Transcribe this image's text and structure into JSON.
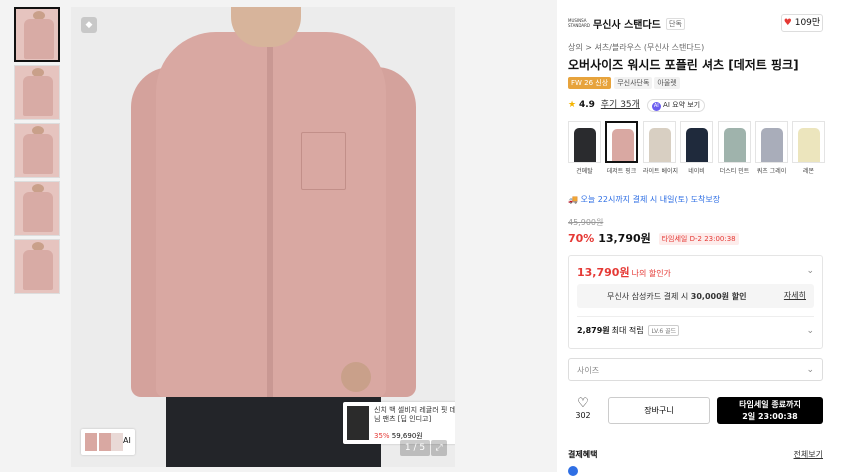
{
  "gallery": {
    "thumbnails": [
      "thumb-1",
      "thumb-2",
      "thumb-3",
      "thumb-4",
      "thumb-5"
    ],
    "pager": "1 / 5",
    "ai_label": "AI",
    "tagged_product": {
      "name": "신치 백 셀비지 레귤러 핏 데님 팬츠 [딥 인디고]",
      "discount": "35%",
      "price": "59,690원"
    }
  },
  "brand": {
    "logo": "MUSINSA STANDARD",
    "name": "무신사 스탠다드",
    "chip": "단독",
    "likes": "109만"
  },
  "breadcrumb": "상의 > 셔츠/블라우스 (무신사 스탠다드)",
  "title": "오버사이즈 워시드 포플린 셔츠 [데저트 핑크]",
  "tags": [
    "FW 26 신상",
    "무신사단독",
    "아울렛"
  ],
  "rating": {
    "score": "4.9",
    "reviews": "후기 35개",
    "ai_summary": "AI 요약 보기"
  },
  "colors": [
    {
      "label": "건메탈",
      "color": "#2a2b2e"
    },
    {
      "label": "데저트 핑크",
      "color": "#d9a8a2",
      "selected": true
    },
    {
      "label": "라이트 베이지",
      "color": "#d8cfc2"
    },
    {
      "label": "네이비",
      "color": "#1f2a3c"
    },
    {
      "label": "더스티 민트",
      "color": "#9fb3ac"
    },
    {
      "label": "쿼츠 그레이",
      "color": "#a9adba"
    },
    {
      "label": "레몬",
      "color": "#ece5bd"
    }
  ],
  "shipping": "오늘 22시까지 결제 시 내일(토) 도착보장",
  "price": {
    "original": "45,900원",
    "discount": "70%",
    "sale": "13,790원",
    "timesale": "타임세일 D-2 23:00:38"
  },
  "benefits": {
    "my_price": "13,790원",
    "my_price_label": "나의 할인가",
    "card_text_prefix": "무신사 삼성카드 결제 시",
    "card_text_amount": "30,000원 할인",
    "card_link": "자세히",
    "points": "2,879원",
    "points_label": "최대 적립",
    "level": "LV.6 골드"
  },
  "size_placeholder": "사이즈",
  "actions": {
    "like_count": "302",
    "cart": "장바구니",
    "buy_line1": "타임세일 종료까지",
    "buy_line2": "2일 23:00:38"
  },
  "payment": {
    "title": "결제혜택",
    "view_all": "전체보기"
  }
}
